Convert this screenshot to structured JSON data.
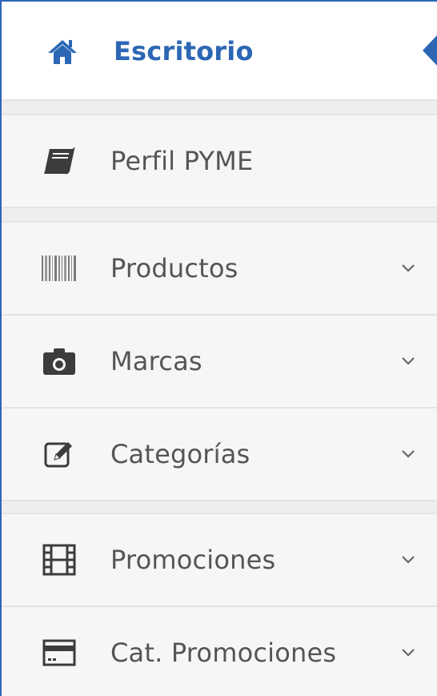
{
  "header": {
    "title": "Escritorio",
    "icon": "home-icon",
    "accent_color": "#2c67b4"
  },
  "menu": {
    "items": [
      {
        "label": "Perfil PYME",
        "icon": "book-icon",
        "has_submenu": false
      },
      {
        "label": "Productos",
        "icon": "barcode-icon",
        "has_submenu": true
      },
      {
        "label": "Marcas",
        "icon": "camera-icon",
        "has_submenu": true
      },
      {
        "label": "Categorías",
        "icon": "edit-icon",
        "has_submenu": true
      },
      {
        "label": "Promociones",
        "icon": "film-icon",
        "has_submenu": true
      },
      {
        "label": "Cat. Promociones",
        "icon": "credit-card-icon",
        "has_submenu": true
      }
    ]
  }
}
